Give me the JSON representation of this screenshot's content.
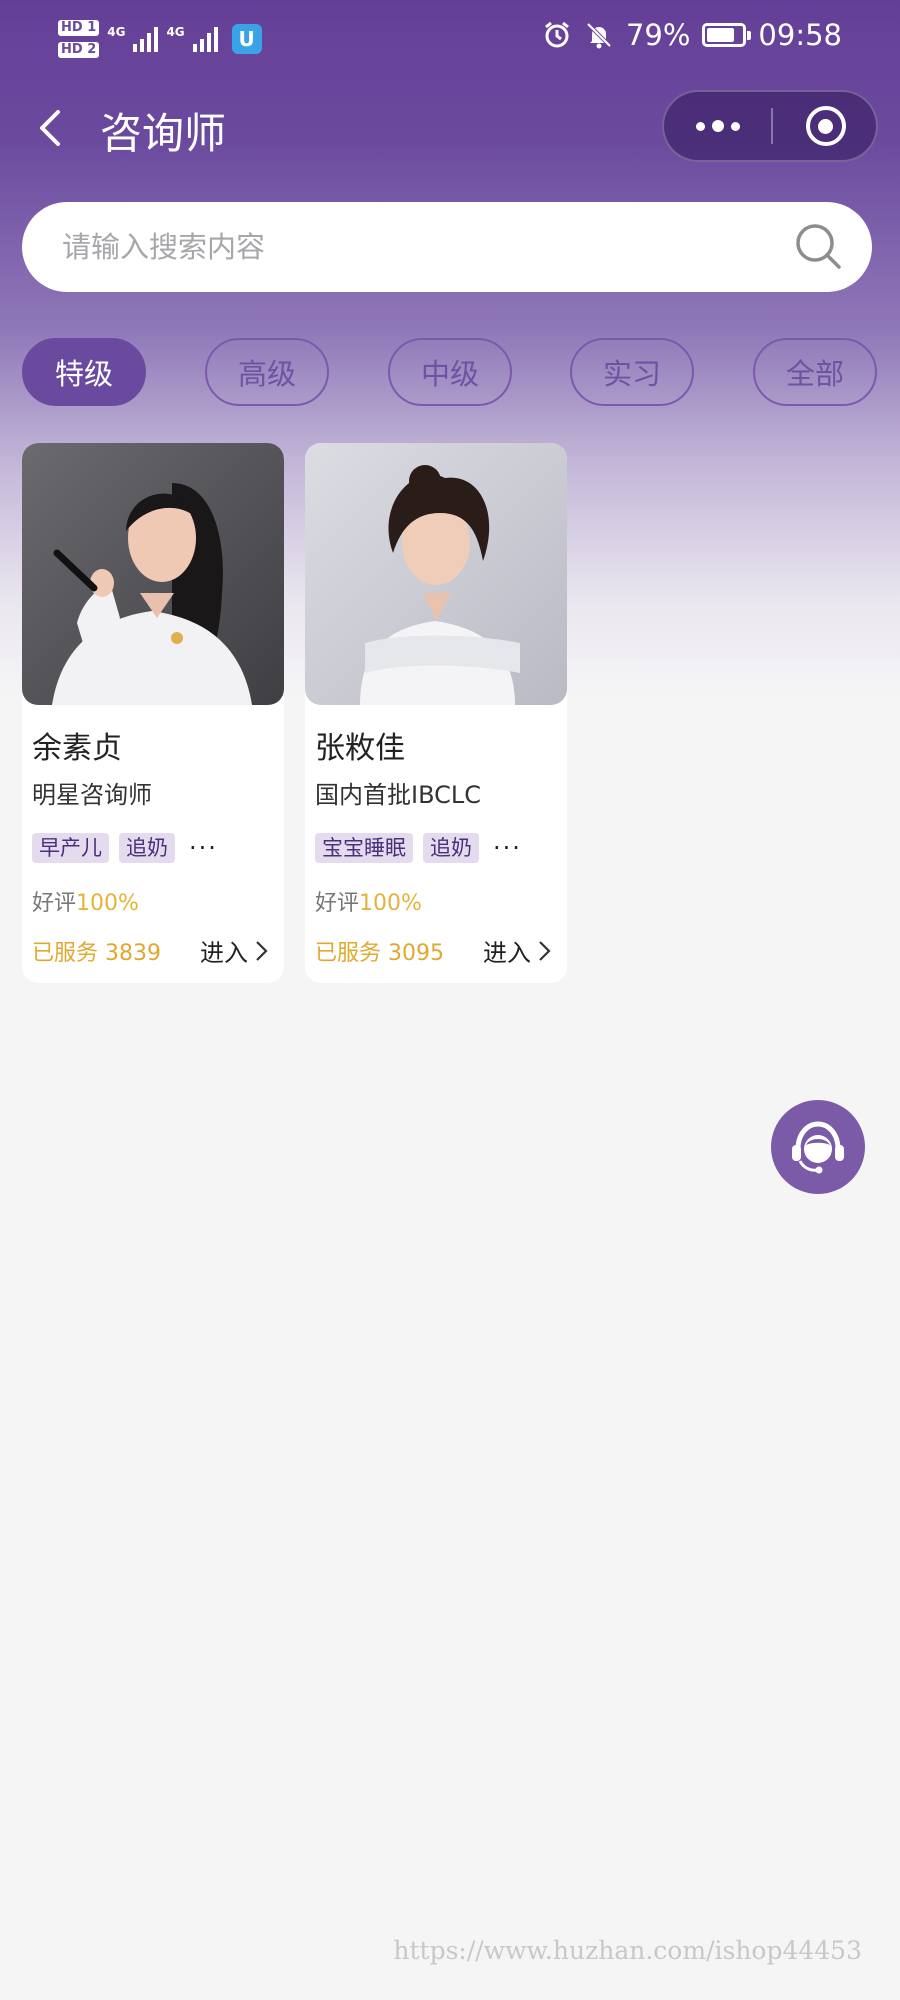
{
  "status_bar": {
    "sim1": "HD 1",
    "sim2": "HD 2",
    "net1": "4G",
    "net2": "4G",
    "app_badge": "U",
    "battery": "79%",
    "battery_level": 0.79,
    "time": "09:58"
  },
  "nav": {
    "title": "咨询师"
  },
  "search": {
    "placeholder": "请输入搜索内容"
  },
  "filters": [
    {
      "label": "特级",
      "active": true
    },
    {
      "label": "高级",
      "active": false
    },
    {
      "label": "中级",
      "active": false
    },
    {
      "label": "实习",
      "active": false
    },
    {
      "label": "全部",
      "active": false
    }
  ],
  "consultants": [
    {
      "name": "余素贞",
      "title": "明星咨询师",
      "tags": [
        "早产儿",
        "追奶"
      ],
      "more": "···",
      "rating_label": "好评",
      "rating_value": "100%",
      "served": "已服务 3839",
      "enter": "进入"
    },
    {
      "name": "张敉佳",
      "title": "国内首批IBCLC",
      "tags": [
        "宝宝睡眠",
        "追奶"
      ],
      "more": "···",
      "rating_label": "好评",
      "rating_value": "100%",
      "served": "已服务 3095",
      "enter": "进入"
    }
  ],
  "watermark": "https://www.huzhan.com/ishop44453",
  "colors": {
    "brand": "#6a4a9e",
    "tag_bg": "#e4dcee",
    "accent_gold": "#e0a92d"
  }
}
